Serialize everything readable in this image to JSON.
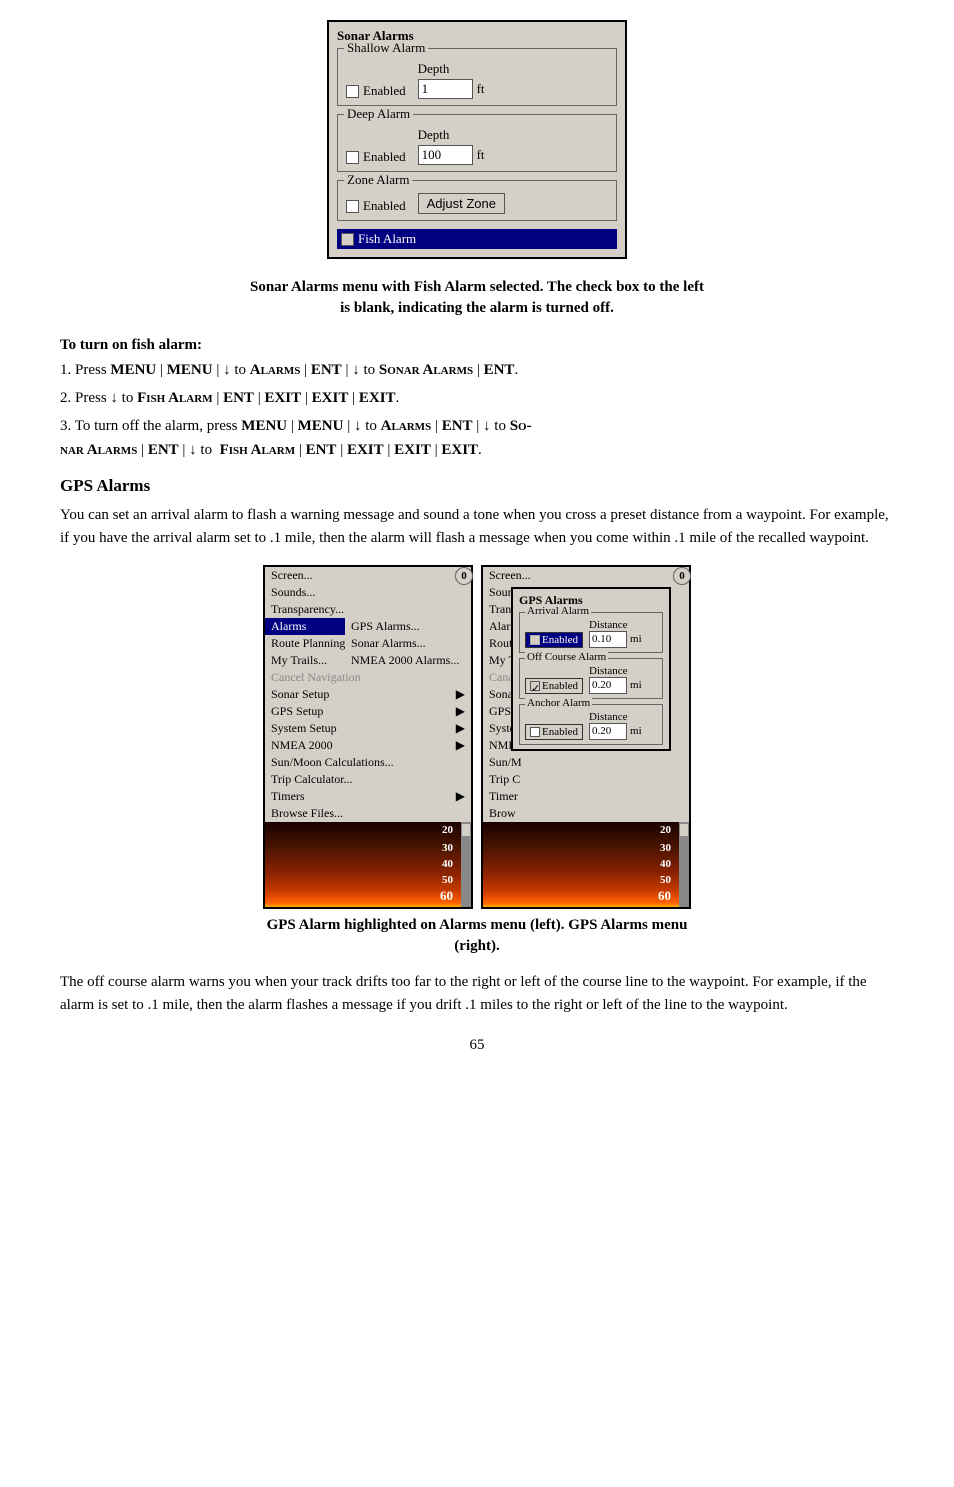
{
  "sonar_dialog": {
    "title": "Sonar Alarms",
    "shallow_alarm": {
      "label": "Shallow Alarm",
      "enabled_label": "Enabled",
      "depth_label": "Depth",
      "depth_value": "1",
      "unit": "ft"
    },
    "deep_alarm": {
      "label": "Deep Alarm",
      "enabled_label": "Enabled",
      "depth_label": "Depth",
      "depth_value": "100",
      "unit": "ft"
    },
    "zone_alarm": {
      "label": "Zone Alarm",
      "enabled_label": "Enabled",
      "adjust_btn": "Adjust Zone"
    },
    "fish_alarm": {
      "label": "Fish Alarm"
    }
  },
  "caption1": {
    "line1": "Sonar Alarms menu with Fish Alarm selected. The check box to the left",
    "line2": "is blank, indicating the alarm is turned off."
  },
  "instructions": {
    "heading": "To turn on fish alarm:",
    "step1": "1. Press MENU | MENU | ↓ to ALARMS | ENT | ↓ to SONAR ALARMS | ENT.",
    "step2": "2. Press ↓ to FISH ALARM | ENT | EXIT | EXIT | EXIT.",
    "step3_pre": "3. To turn off the alarm, press MENU | MENU | ↓ to ALARMS | ENT | ↓ to SO-",
    "step3_post": "NAR ALARMS | ENT | ↓ to  FISH ALARM | ENT | EXIT | EXIT | EXIT."
  },
  "gps_alarms_heading": "GPS Alarms",
  "gps_body": "You can set an arrival alarm to flash a warning message and sound a tone when you cross a preset distance from a waypoint. For example, if you have the arrival alarm set to .1 mile, then the alarm will flash a message when you come within .1 mile of the recalled waypoint.",
  "left_menu": {
    "items": [
      {
        "label": "Screen...",
        "arrow": true,
        "style": "normal"
      },
      {
        "label": "Sounds...",
        "arrow": false,
        "style": "normal"
      },
      {
        "label": "Transparency...",
        "arrow": false,
        "style": "normal"
      },
      {
        "label": "Alarms",
        "arrow": false,
        "style": "highlight",
        "sub": "GPS Alarms..."
      },
      {
        "label": "Route Planning",
        "arrow": false,
        "style": "normal",
        "sub": "Sonar Alarms..."
      },
      {
        "label": "My Trails...",
        "arrow": false,
        "style": "normal",
        "sub": "NMEA 2000 Alarms..."
      },
      {
        "label": "Cancel Navigation",
        "arrow": false,
        "style": "disabled"
      },
      {
        "label": "Sonar Setup",
        "arrow": true,
        "style": "normal"
      },
      {
        "label": "GPS Setup",
        "arrow": true,
        "style": "normal"
      },
      {
        "label": "System Setup",
        "arrow": true,
        "style": "normal"
      },
      {
        "label": "NMEA 2000",
        "arrow": true,
        "style": "normal"
      },
      {
        "label": "Sun/Moon Calculations...",
        "arrow": false,
        "style": "normal"
      },
      {
        "label": "Trip Calculator...",
        "arrow": false,
        "style": "normal"
      },
      {
        "label": "Timers",
        "arrow": true,
        "style": "normal"
      },
      {
        "label": "Browse Files...",
        "arrow": false,
        "style": "normal"
      }
    ],
    "sonar_labels": [
      "20",
      "30",
      "40",
      "50",
      "60"
    ]
  },
  "right_menu": {
    "top_items": [
      {
        "label": "Screen...",
        "arrow": true
      },
      {
        "label": "Sounds...",
        "arrow": false
      },
      {
        "label": "Transparency...",
        "arrow": false
      }
    ],
    "gps_alarms_panel": {
      "title": "GPS Alarms",
      "arrival": {
        "section": "Arrival Alarm",
        "enabled": true,
        "distance_label": "Distance",
        "distance_value": "0.10",
        "unit": "mi"
      },
      "off_course": {
        "section": "Off Course Alarm",
        "enabled": true,
        "distance_label": "Distance",
        "distance_value": "0.20",
        "unit": "mi"
      },
      "anchor": {
        "section": "Anchor Alarm",
        "enabled": false,
        "distance_label": "Distance",
        "distance_value": "0.20",
        "unit": "mi"
      }
    },
    "sonar_labels": [
      "20",
      "30",
      "40",
      "50",
      "60"
    ]
  },
  "caption2": {
    "line1": "GPS Alarm highlighted on Alarms menu (left). GPS Alarms menu",
    "line2": "(right)."
  },
  "off_course_text": "The off course alarm warns you when your track drifts too far to the right or left of the course line to the waypoint. For example, if the alarm is set to .1 mile, then the alarm flashes a message if you drift .1 miles to the right or left of the line to the waypoint.",
  "page_number": "65"
}
